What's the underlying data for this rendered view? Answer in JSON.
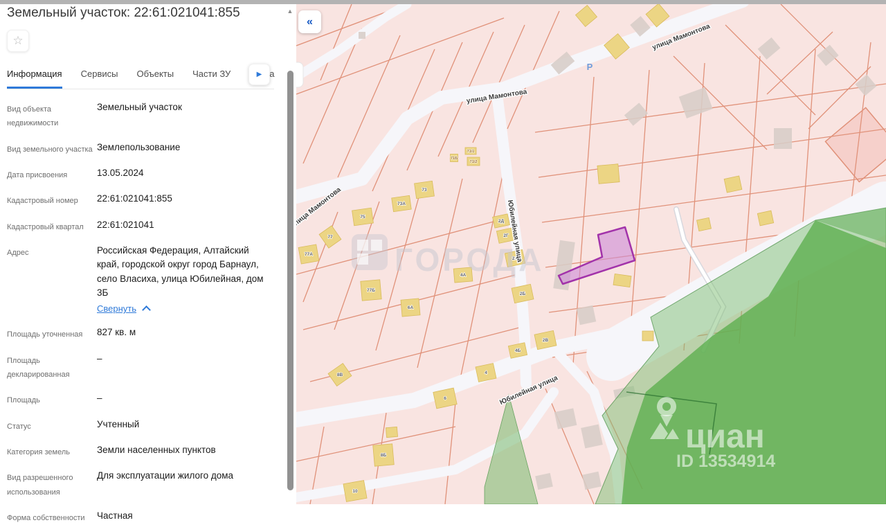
{
  "panel": {
    "title": "Земельный участок: 22:61:021041:855",
    "star_icon": "☆",
    "scroll_up_icon": "▲",
    "tabs": [
      {
        "label": "Информация"
      },
      {
        "label": "Сервисы"
      },
      {
        "label": "Объекты"
      },
      {
        "label": "Части ЗУ"
      },
      {
        "label": "Соста"
      }
    ],
    "tab_next_icon": "▶",
    "address_collapse_label": "Свернуть",
    "rows": [
      {
        "label": "Вид объекта недвижимости",
        "value": "Земельный участок"
      },
      {
        "label": "Вид земельного участка",
        "value": "Землепользование"
      },
      {
        "label": "Дата присвоения",
        "value": "13.05.2024"
      },
      {
        "label": "Кадастровый номер",
        "value": "22:61:021041:855"
      },
      {
        "label": "Кадастровый квартал",
        "value": "22:61:021041"
      },
      {
        "label": "Адрес",
        "value": "Российская Федерация, Алтайский край, городской округ город Барнаул, село Власиха, улица Юбилейная, дом 3Б"
      },
      {
        "label": "Площадь уточненная",
        "value": "827 кв. м"
      },
      {
        "label": "Площадь декларированная",
        "value": "–"
      },
      {
        "label": "Площадь",
        "value": "–"
      },
      {
        "label": "Статус",
        "value": "Учтенный"
      },
      {
        "label": "Категория земель",
        "value": "Земли населенных пунктов"
      },
      {
        "label": "Вид разрешенного использования",
        "value": "Для эксплуатации жилого дома"
      },
      {
        "label": "Форма собственности",
        "value": "Частная"
      }
    ]
  },
  "map": {
    "collapse_button_icon": "«",
    "parking_label": "Р",
    "street_labels": [
      "улица Мамонтова",
      "улица Мамонтова",
      "улица Мамонтова",
      "Юбилейная улица",
      "Юбилейная улица"
    ],
    "parcel_labels": [
      "73",
      "73А",
      "75",
      "77",
      "77А",
      "77Б",
      "6А",
      "4А",
      "2Д",
      "2Г",
      "2А",
      "2Б",
      "2В",
      "4Б",
      "4",
      "6",
      "8В",
      "8Б",
      "10",
      "71Б",
      "71/1",
      "71/2"
    ],
    "watermark": {
      "brand": "циан",
      "id_text": "ID 13534914"
    },
    "watermark_goroda": "ГОРОДА",
    "colors": {
      "accent_blue": "#2f7ad9",
      "parcel_highlight": "#a233aa",
      "forest_green": "#63b25c",
      "parcel_line": "#e09179"
    }
  }
}
